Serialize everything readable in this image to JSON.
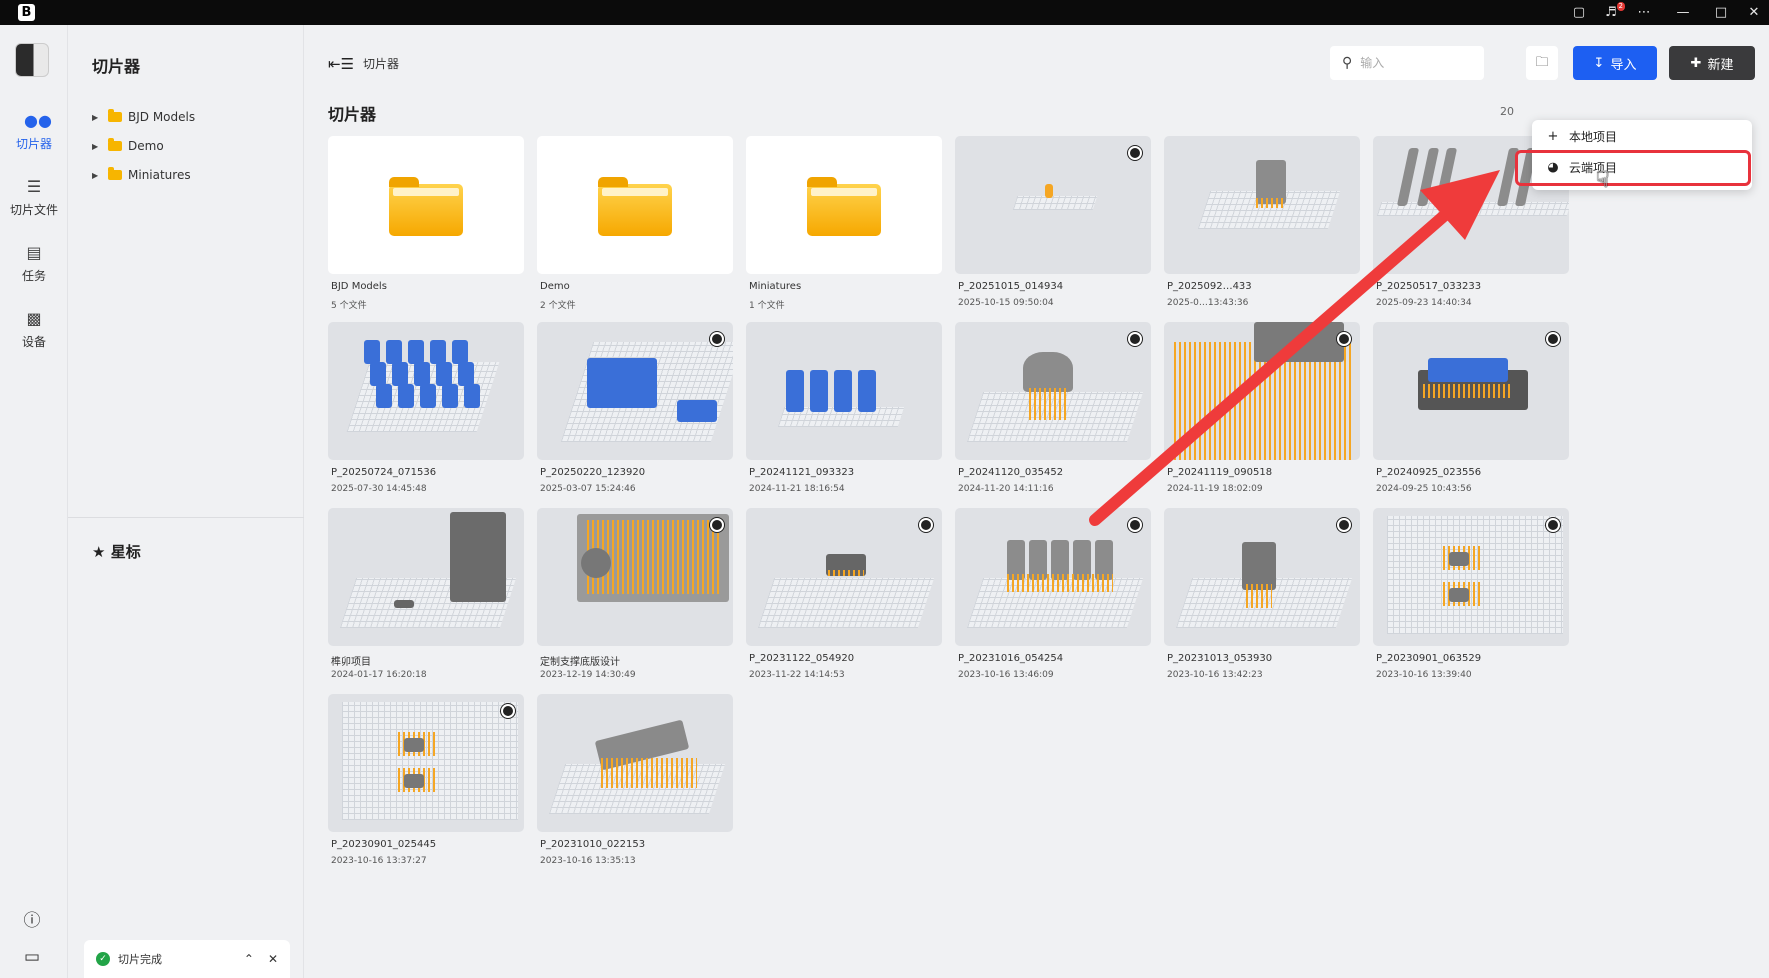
{
  "titlebar": {
    "notif_count": "2"
  },
  "rail": {
    "items": [
      {
        "label": "切片器",
        "icon": "slicer-icon"
      },
      {
        "label": "切片文件",
        "icon": "layers-icon"
      },
      {
        "label": "任务",
        "icon": "task-icon"
      },
      {
        "label": "设备",
        "icon": "printer-icon"
      }
    ]
  },
  "sidebar": {
    "title": "切片器",
    "folders": [
      "BJD Models",
      "Demo",
      "Miniatures"
    ],
    "starred_title": "星标"
  },
  "toast": {
    "message": "切片完成"
  },
  "main": {
    "breadcrumb": "切片器",
    "search_placeholder": "输入",
    "import_label": "导入",
    "new_label": "新建",
    "section_title": "切片器",
    "count": "20",
    "dropdown": {
      "items": [
        {
          "label": "本地项目",
          "icon": "plus-icon"
        },
        {
          "label": "云端项目",
          "icon": "cloud-icon"
        }
      ]
    },
    "items": [
      {
        "name": "BJD Models",
        "sub": "5 个文件",
        "type": "folder"
      },
      {
        "name": "Demo",
        "sub": "2 个文件",
        "type": "folder"
      },
      {
        "name": "Miniatures",
        "sub": "1 个文件",
        "type": "folder"
      },
      {
        "name": "P_20251015_014934",
        "sub": "2025-10-15 09:50:04",
        "type": "project",
        "cloud": true
      },
      {
        "name": "P_2025092…433",
        "sub": "2025-0…13:43:36",
        "type": "project",
        "cloud": false
      },
      {
        "name": "P_20250517_033233",
        "sub": "2025-09-23 14:40:34",
        "type": "project",
        "cloud": false
      },
      {
        "name": "P_20250724_071536",
        "sub": "2025-07-30 14:45:48",
        "type": "project",
        "cloud": false
      },
      {
        "name": "P_20250220_123920",
        "sub": "2025-03-07 15:24:46",
        "type": "project",
        "cloud": true
      },
      {
        "name": "P_20241121_093323",
        "sub": "2024-11-21 18:16:54",
        "type": "project",
        "cloud": false
      },
      {
        "name": "P_20241120_035452",
        "sub": "2024-11-20 14:11:16",
        "type": "project",
        "cloud": true
      },
      {
        "name": "P_20241119_090518",
        "sub": "2024-11-19 18:02:09",
        "type": "project",
        "cloud": true
      },
      {
        "name": "P_20240925_023556",
        "sub": "2024-09-25 10:43:56",
        "type": "project",
        "cloud": true
      },
      {
        "name": "榫卯项目",
        "sub": "2024-01-17 16:20:18",
        "type": "project",
        "cloud": false
      },
      {
        "name": "定制支撑底版设计",
        "sub": "2023-12-19 14:30:49",
        "type": "project",
        "cloud": true
      },
      {
        "name": "P_20231122_054920",
        "sub": "2023-11-22 14:14:53",
        "type": "project",
        "cloud": true
      },
      {
        "name": "P_20231016_054254",
        "sub": "2023-10-16 13:46:09",
        "type": "project",
        "cloud": true
      },
      {
        "name": "P_20231013_053930",
        "sub": "2023-10-16 13:42:23",
        "type": "project",
        "cloud": true
      },
      {
        "name": "P_20230901_063529",
        "sub": "2023-10-16 13:39:40",
        "type": "project",
        "cloud": true
      },
      {
        "name": "P_20230901_025445",
        "sub": "2023-10-16 13:37:27",
        "type": "project",
        "cloud": true
      },
      {
        "name": "P_20231010_022153",
        "sub": "2023-10-16 13:35:13",
        "type": "project",
        "cloud": false
      }
    ]
  },
  "colors": {
    "accent": "#1d5ff2",
    "highlight": "#e8323c",
    "support_orange": "#f5a623",
    "model_blue": "#3a6fd8",
    "model_gray": "#8a8a8a"
  }
}
